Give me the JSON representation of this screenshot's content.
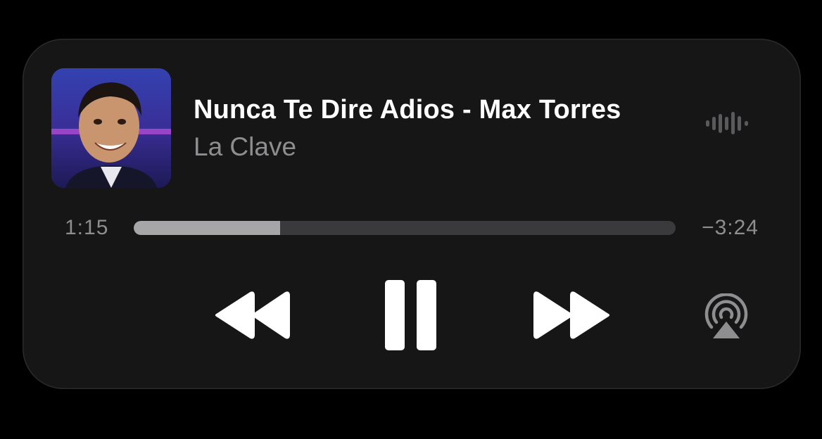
{
  "now_playing": {
    "title": "Nunca Te Dire Adios - Max Torres",
    "subtitle": "La Clave",
    "artwork_icon": "album-artwork",
    "status_icon": "audio-waveform-icon"
  },
  "progress": {
    "elapsed": "1:15",
    "remaining": "−3:24",
    "fraction": 0.27
  },
  "controls": {
    "rewind_icon": "rewind-icon",
    "pause_icon": "pause-icon",
    "forward_icon": "fast-forward-icon",
    "airplay_icon": "airplay-audio-icon"
  },
  "colors": {
    "background": "#000000",
    "panel": "#161616",
    "primary_text": "#ffffff",
    "secondary_text": "#8e8e90",
    "track": "#3a3a3c",
    "track_fill": "#a6a6a8"
  }
}
